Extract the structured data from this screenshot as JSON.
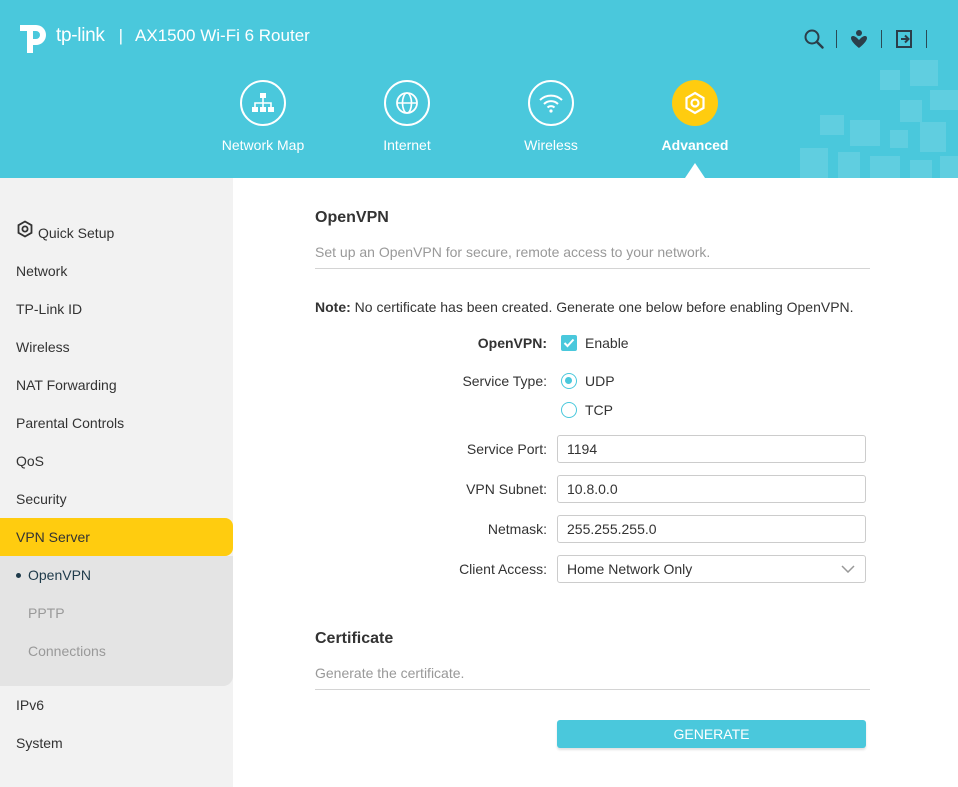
{
  "header": {
    "brand": "tp-link",
    "separator": "|",
    "model": "AX1500 Wi-Fi 6 Router",
    "icons": [
      "search-icon",
      "support-icon",
      "logout-icon"
    ]
  },
  "nav": {
    "items": [
      {
        "label": "Network Map",
        "icon": "network-map-icon"
      },
      {
        "label": "Internet",
        "icon": "globe-icon"
      },
      {
        "label": "Wireless",
        "icon": "wifi-icon"
      },
      {
        "label": "Advanced",
        "icon": "advanced-gear-icon",
        "active": true
      }
    ]
  },
  "sidebar": {
    "items": [
      {
        "label": "Quick Setup",
        "icon": "gear-icon"
      },
      {
        "label": "Network"
      },
      {
        "label": "TP-Link ID"
      },
      {
        "label": "Wireless"
      },
      {
        "label": "NAT Forwarding"
      },
      {
        "label": "Parental Controls"
      },
      {
        "label": "QoS"
      },
      {
        "label": "Security"
      },
      {
        "label": "VPN Server",
        "active": true
      },
      {
        "label": "IPv6"
      },
      {
        "label": "System"
      }
    ],
    "subitems": [
      {
        "label": "OpenVPN",
        "active": true
      },
      {
        "label": "PPTP"
      },
      {
        "label": "Connections"
      }
    ]
  },
  "openvpn": {
    "title": "OpenVPN",
    "description": "Set up an OpenVPN for secure, remote access to your network.",
    "note_label": "Note:",
    "note_text": " No certificate has been created. Generate one below before enabling OpenVPN.",
    "enable_label": "OpenVPN:",
    "enable_option": "Enable",
    "enable_checked": true,
    "service_type_label": "Service Type:",
    "service_types": [
      "UDP",
      "TCP"
    ],
    "service_type_selected": "UDP",
    "service_port_label": "Service Port:",
    "service_port": "1194",
    "vpn_subnet_label": "VPN Subnet:",
    "vpn_subnet": "10.8.0.0",
    "netmask_label": "Netmask:",
    "netmask": "255.255.255.0",
    "client_access_label": "Client Access:",
    "client_access": "Home Network Only"
  },
  "certificate": {
    "title": "Certificate",
    "description": "Generate the certificate.",
    "button": "GENERATE"
  },
  "colors": {
    "header": "#4ac8dc",
    "accent": "#ffcc0f",
    "sidebar": "#f2f2f2"
  }
}
